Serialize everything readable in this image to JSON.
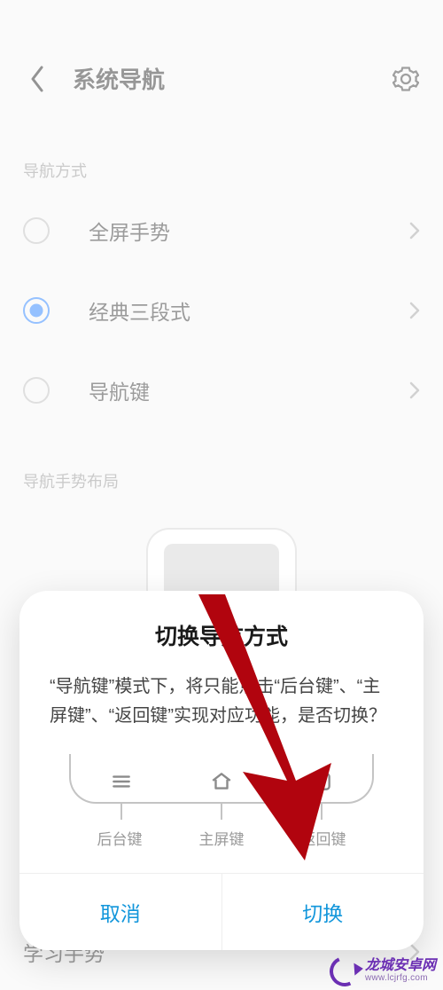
{
  "header": {
    "title": "系统导航"
  },
  "sections": {
    "navModeLabel": "导航方式",
    "layoutLabel": "导航手势布局",
    "learnRow": "学习手势"
  },
  "options": [
    {
      "label": "全屏手势",
      "selected": false
    },
    {
      "label": "经典三段式",
      "selected": true
    },
    {
      "label": "导航键",
      "selected": false
    }
  ],
  "dialog": {
    "title": "切换导航方式",
    "message": "“导航键”模式下，将只能点击“后台键”、“主屏键”、“返回键”实现对应功能，是否切换？",
    "navLabels": [
      "后台键",
      "主屏键",
      "返回键"
    ],
    "cancel": "取消",
    "confirm": "切换"
  },
  "watermark": {
    "name": "龙城安卓网",
    "url": "www.lcjrfg.com"
  }
}
